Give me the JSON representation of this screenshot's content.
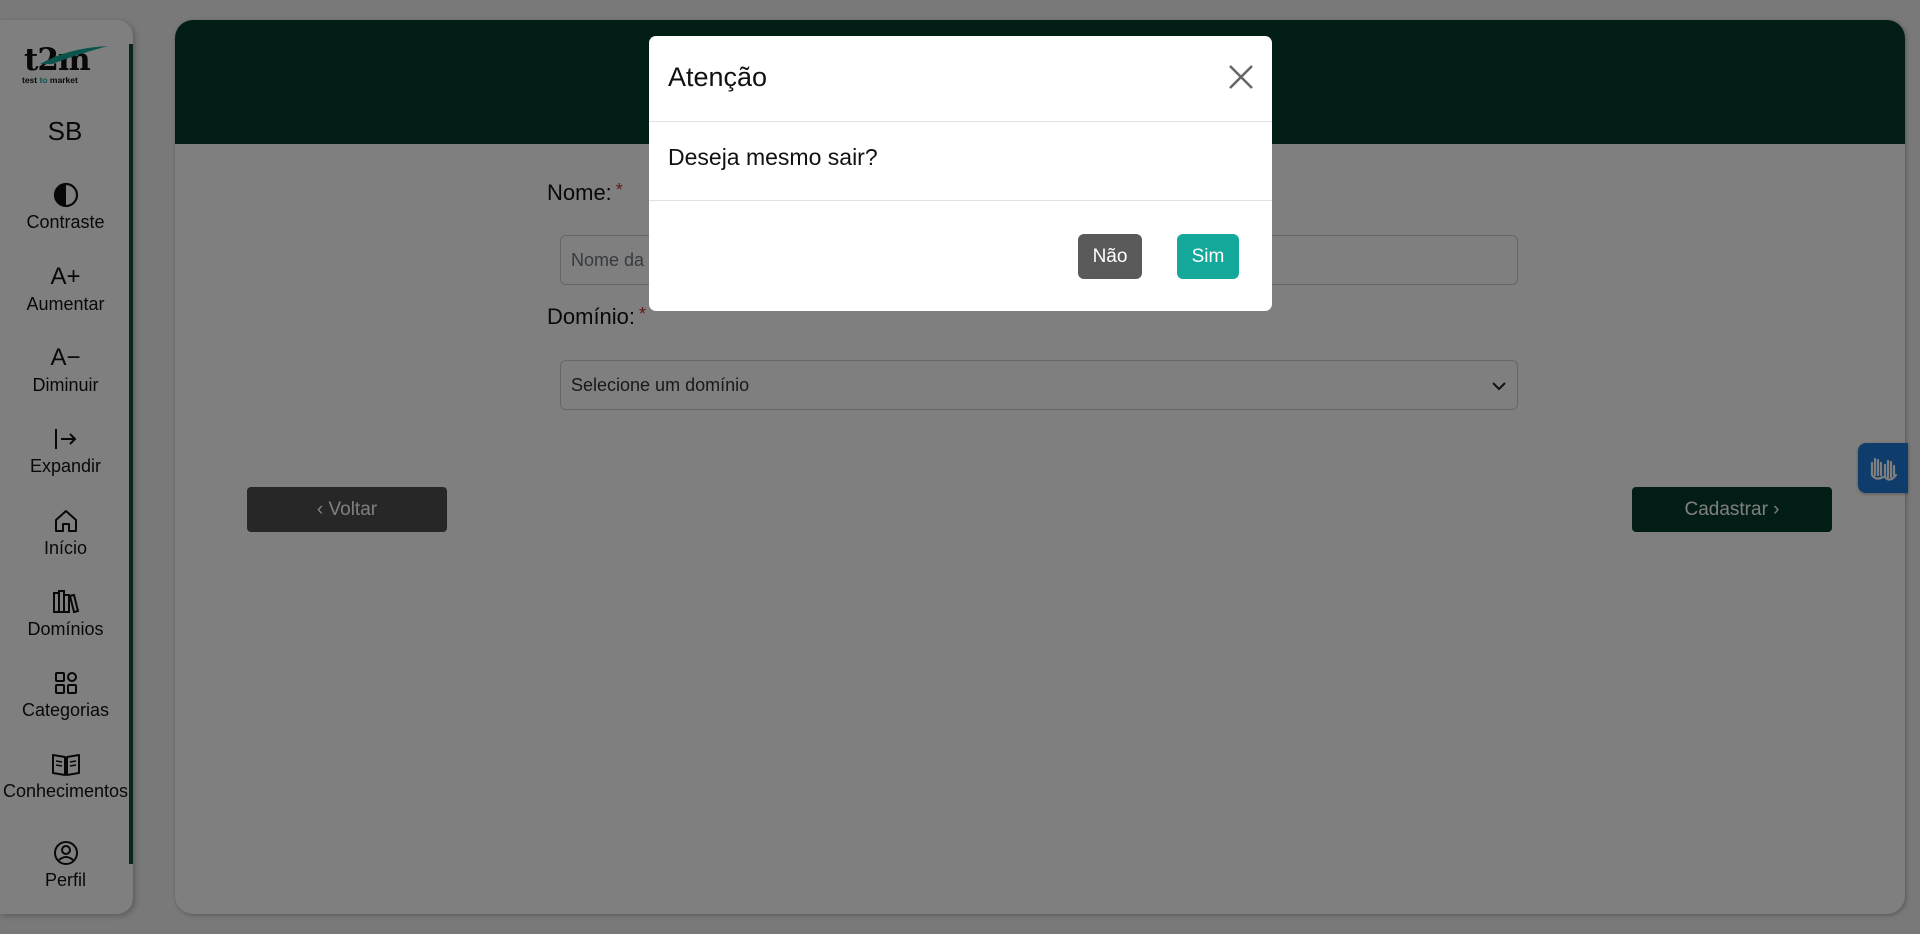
{
  "sidebar": {
    "logo_text": "t2m",
    "logo_subtext_1": "test",
    "logo_subtext_accent": "to",
    "logo_subtext_2": "market",
    "initials": "SB",
    "items": [
      {
        "label": "Contraste",
        "icon": "contrast-icon"
      },
      {
        "label": "Aumentar",
        "icon": "increase-font-icon",
        "glyph": "A+"
      },
      {
        "label": "Diminuir",
        "icon": "decrease-font-icon",
        "glyph": "A−"
      },
      {
        "label": "Expandir",
        "icon": "expand-icon"
      },
      {
        "label": "Início",
        "icon": "home-icon"
      },
      {
        "label": "Domínios",
        "icon": "books-icon"
      },
      {
        "label": "Categorias",
        "icon": "grid-icon"
      },
      {
        "label": "Conhecimentos",
        "icon": "book-open-icon"
      },
      {
        "label": "Perfil",
        "icon": "user-circle-icon"
      }
    ]
  },
  "form": {
    "name_label": "Nome:",
    "name_required": "*",
    "name_placeholder": "Nome da",
    "domain_label": "Domínio:",
    "domain_required": "*",
    "domain_selected": "Selecione um domínio"
  },
  "actions": {
    "back_label": "‹ Voltar",
    "submit_label": "Cadastrar ›"
  },
  "modal": {
    "title": "Atenção",
    "message": "Deseja mesmo sair?",
    "no_label": "Não",
    "yes_label": "Sim"
  },
  "colors": {
    "header_green": "#033a2d",
    "accent_teal": "#14a89a",
    "no_button": "#5a5a5a",
    "back_button": "#4f4f4f",
    "a11y_blue": "#1f7bd6"
  }
}
